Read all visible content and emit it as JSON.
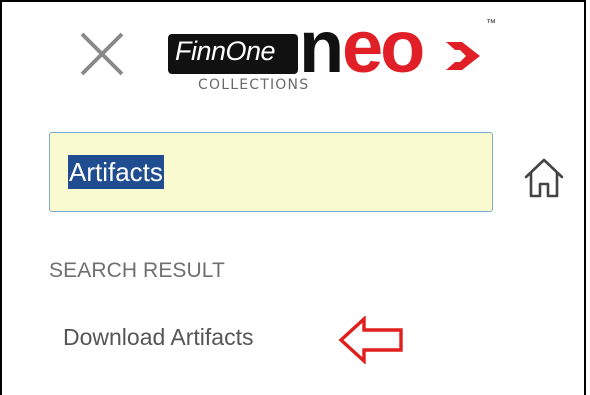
{
  "header": {
    "close_icon": "close-icon",
    "logo": {
      "box_text": "FinnOne",
      "word_dark": "n",
      "word_red": "eo",
      "subtitle": "COLLECTIONS",
      "trademark": "™",
      "colors": {
        "dark": "#111111",
        "red": "#e01f26"
      }
    }
  },
  "search": {
    "value": "Artifacts",
    "background": "#fafad1",
    "selection_color": "#1f4d8f"
  },
  "home_icon": "home-icon",
  "results": {
    "section_label": "SEARCH RESULT",
    "items": [
      {
        "label": "Download Artifacts"
      }
    ]
  },
  "annotation": {
    "arrow_icon": "left-arrow-outline-icon",
    "color": "#e0201c"
  }
}
